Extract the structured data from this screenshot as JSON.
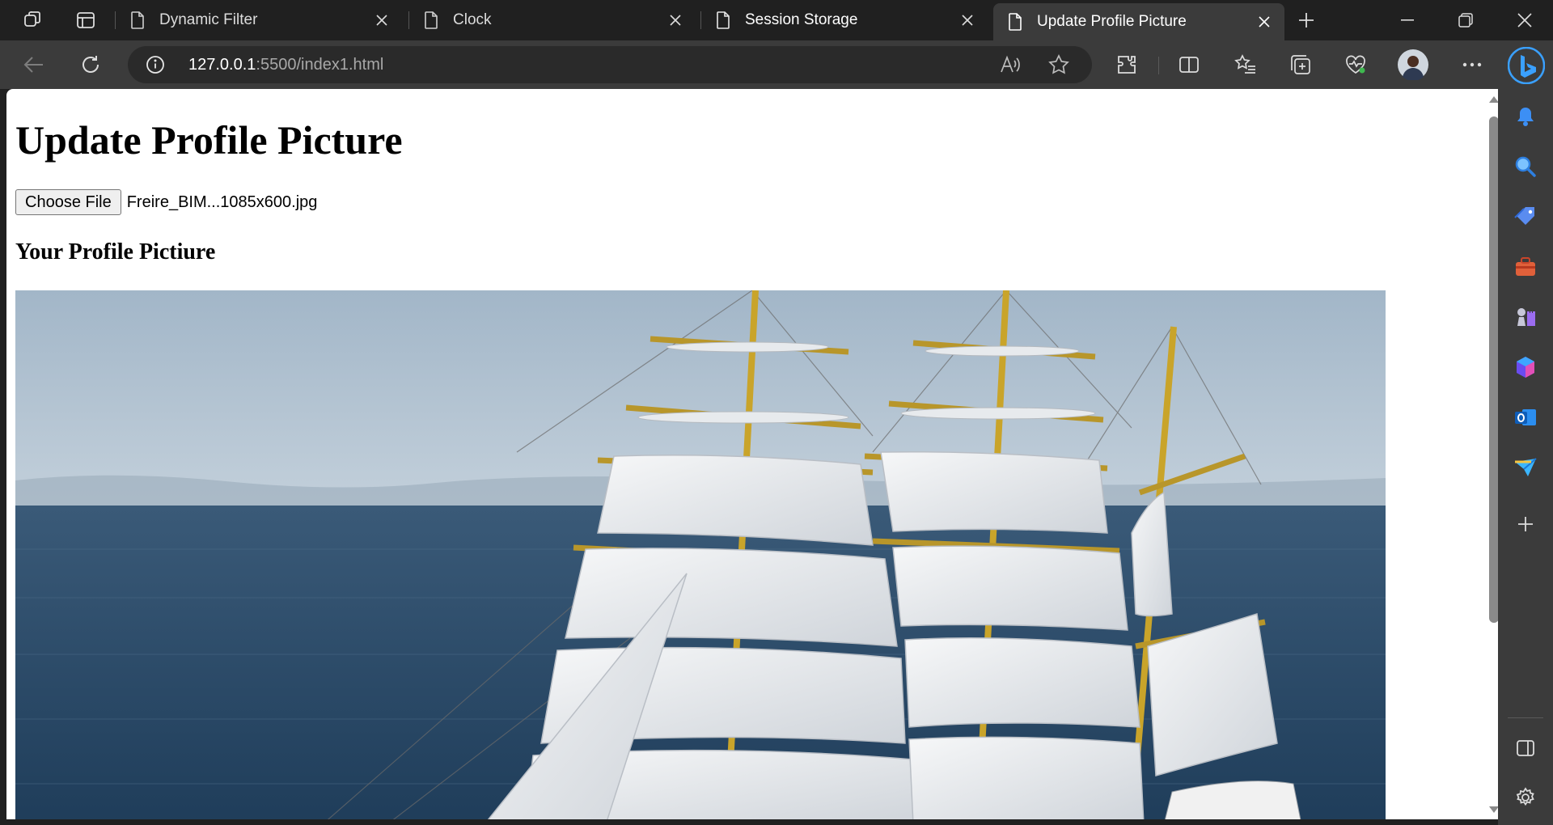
{
  "browser": {
    "tabs": [
      {
        "title": "Dynamic Filter",
        "active": false
      },
      {
        "title": "Clock",
        "active": false
      },
      {
        "title": "Session Storage",
        "active": false
      },
      {
        "title": "Update Profile Picture",
        "active": true
      }
    ],
    "address": {
      "host": "127.0.0.1",
      "rest": ":5500/index1.html"
    }
  },
  "page": {
    "title": "Update Profile Picture",
    "file_button_label": "Choose File",
    "file_name": "Freire_BIM...1085x600.jpg",
    "subheading": "Your Profile Pictiure"
  },
  "colors": {
    "chrome_bg": "#202020",
    "toolbar_bg": "#3b3b3b",
    "page_bg": "#ffffff",
    "sky": "#a9bccd",
    "sea": "#2c4a66",
    "sail": "#eef0f2",
    "mast": "#c9a42a"
  }
}
